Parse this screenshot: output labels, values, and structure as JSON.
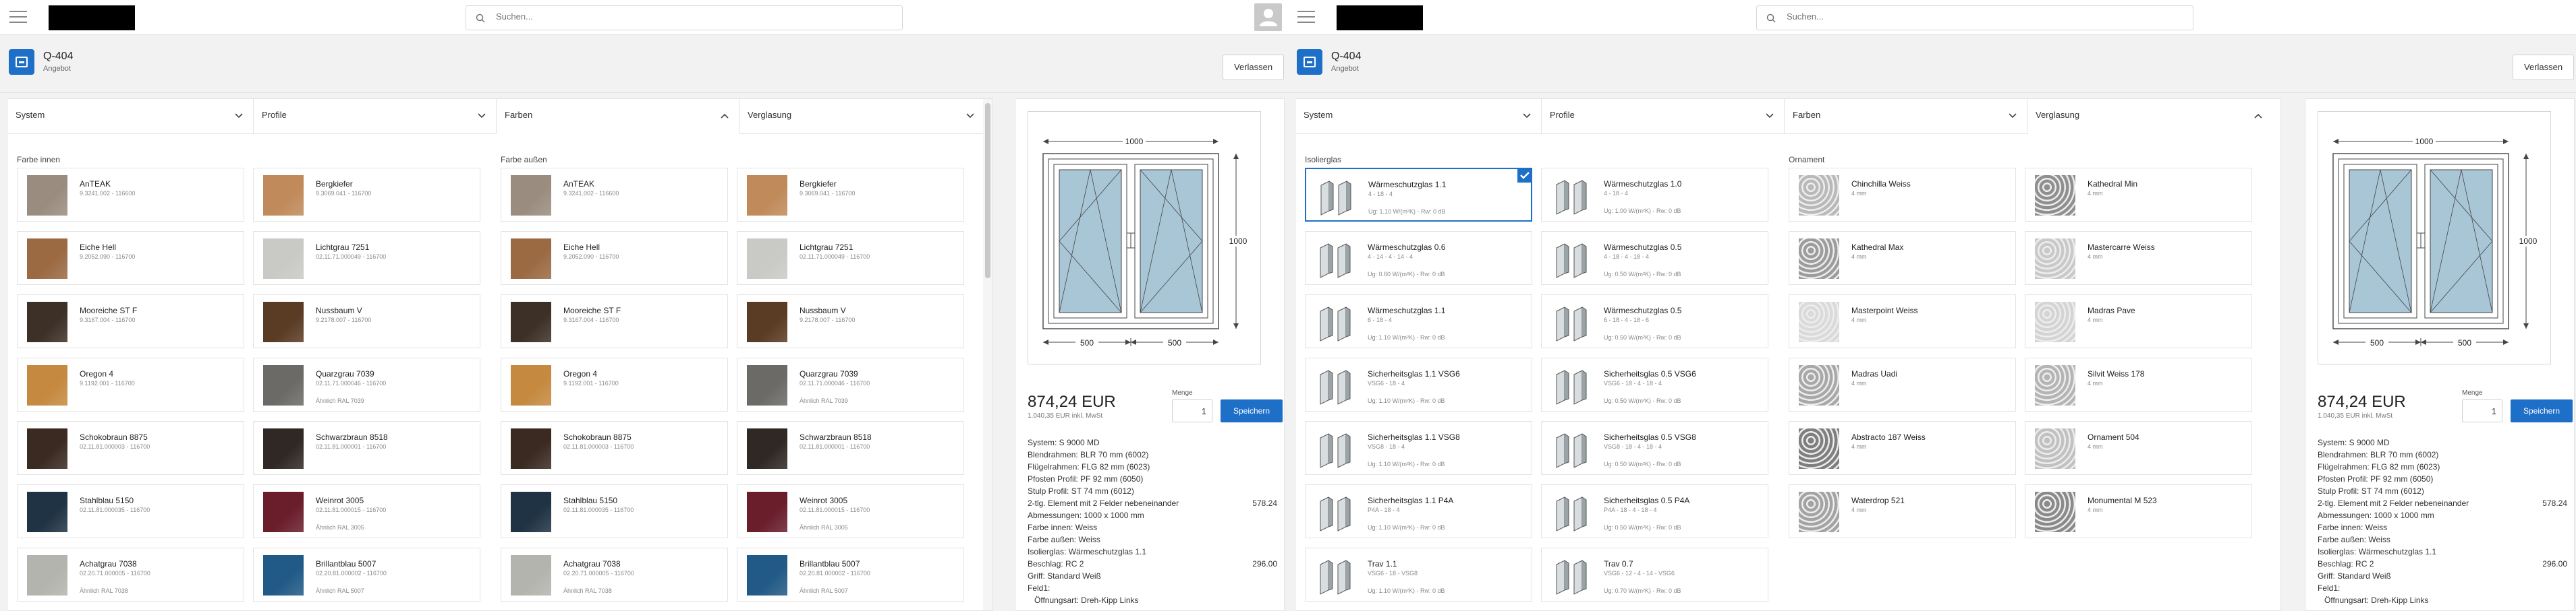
{
  "left": {
    "search_placeholder": "Suchen...",
    "quote_title": "Q-404",
    "quote_subtitle": "Angebot",
    "leave_label": "Verlassen",
    "tabs": [
      "System",
      "Profile",
      "Farben",
      "Verglasung"
    ],
    "section_inner": "Farbe innen",
    "section_outer": "Farbe außen",
    "colors": [
      {
        "name": "AnTEAK",
        "code": "9.3241.002 - 116600",
        "note": "",
        "color": "#9a8d80"
      },
      {
        "name": "Bergkiefer",
        "code": "9.3069.041 - 116700",
        "note": "",
        "color": "#c08a5a"
      },
      {
        "name": "Eiche Hell",
        "code": "9.2052.090 - 116700",
        "note": "",
        "color": "#9b6a43"
      },
      {
        "name": "Lichtgrau 7251",
        "code": "02.11.71.000049 - 116700",
        "note": "",
        "color": "#c9c9c6"
      },
      {
        "name": "Mooreiche ST F",
        "code": "9.3167.004 - 116700",
        "note": "",
        "color": "#3c3027"
      },
      {
        "name": "Nussbaum V",
        "code": "9.2178.007 - 116700",
        "note": "",
        "color": "#5a3b24"
      },
      {
        "name": "Oregon 4",
        "code": "9.1192.001 - 116700",
        "note": "",
        "color": "#c5893f"
      },
      {
        "name": "Quarzgrau 7039",
        "code": "02.11.71.000046 - 116700",
        "note": "Ähnlich RAL 7039",
        "color": "#6b6a66"
      },
      {
        "name": "Schokobraun 8875",
        "code": "02.11.81.000003 - 116700",
        "note": "",
        "color": "#3a2a22"
      },
      {
        "name": "Schwarzbraun 8518",
        "code": "02.11.81.000001 - 116700",
        "note": "",
        "color": "#2f2824"
      },
      {
        "name": "Stahlblau 5150",
        "code": "02.11.81.000035 - 116700",
        "note": "",
        "color": "#1f3344"
      },
      {
        "name": "Weinrot 3005",
        "code": "02.11.81.000015 - 116700",
        "note": "Ähnlich RAL 3005",
        "color": "#6a1e2c"
      },
      {
        "name": "Achatgrau 7038",
        "code": "02.20.71.000005 - 116700",
        "note": "Ähnlich RAL 7038",
        "color": "#b3b4ad"
      },
      {
        "name": "Brillantblau 5007",
        "code": "02.20.81.000002 - 116700",
        "note": "Ähnlich RAL 5007",
        "color": "#215a86"
      }
    ]
  },
  "right": {
    "search_placeholder": "Suchen...",
    "quote_title": "Q-404",
    "quote_subtitle": "Angebot",
    "leave_label": "Verlassen",
    "tabs": [
      "System",
      "Profile",
      "Farben",
      "Verglasung"
    ],
    "section_glass": "Isolierglas",
    "section_ornament": "Ornament",
    "glass": [
      {
        "name": "Wärmeschutzglas 1.1",
        "spec": "4 - 18 - 4",
        "ug": "Ug: 1.10 W/(m²K) - Rw: 0 dB",
        "selected": true
      },
      {
        "name": "Wärmeschutzglas 1.0",
        "spec": "4 - 18 - 4",
        "ug": "Ug: 1.00 W/(m²K) - Rw: 0 dB",
        "selected": false
      },
      {
        "name": "Wärmeschutzglas 0.6",
        "spec": "4 - 14 - 4 - 14 - 4",
        "ug": "Ug: 0.60 W/(m²K) - Rw: 0 dB",
        "selected": false
      },
      {
        "name": "Wärmeschutzglas 0.5",
        "spec": "4 - 18 - 4 - 18 - 4",
        "ug": "Ug: 0.50 W/(m²K) - Rw: 0 dB",
        "selected": false
      },
      {
        "name": "Wärmeschutzglas 1.1",
        "spec": "6 - 18 - 4",
        "ug": "Ug: 1.10 W/(m²K) - Rw: 0 dB",
        "selected": false
      },
      {
        "name": "Wärmeschutzglas 0.5",
        "spec": "6 - 18 - 4 - 18 - 6",
        "ug": "Ug: 0.50 W/(m²K) - Rw: 0 dB",
        "selected": false
      },
      {
        "name": "Sicherheitsglas 1.1 VSG6",
        "spec": "VSG6 - 18 - 4",
        "ug": "Ug: 1.10 W/(m²K) - Rw: 0 dB",
        "selected": false
      },
      {
        "name": "Sicherheitsglas 0.5 VSG6",
        "spec": "VSG6 - 18 - 4 - 18 - 4",
        "ug": "Ug: 0.50 W/(m²K) - Rw: 0 dB",
        "selected": false
      },
      {
        "name": "Sicherheitsglas 1.1 VSG8",
        "spec": "VSG8 - 18 - 4",
        "ug": "Ug: 1.10 W/(m²K) - Rw: 0 dB",
        "selected": false
      },
      {
        "name": "Sicherheitsglas 0.5 VSG8",
        "spec": "VSG8 - 18 - 4 - 18 - 4",
        "ug": "Ug: 0.50 W/(m²K) - Rw: 0 dB",
        "selected": false
      },
      {
        "name": "Sicherheitsglas 1.1 P4A",
        "spec": "P4A - 18 - 4",
        "ug": "Ug: 1.10 W/(m²K) - Rw: 0 dB",
        "selected": false
      },
      {
        "name": "Sicherheitsglas 0.5 P4A",
        "spec": "P4A - 18 - 4 - 18 - 4",
        "ug": "Ug: 0.50 W/(m²K) - Rw: 0 dB",
        "selected": false
      },
      {
        "name": "Trav 1.1",
        "spec": "VSG6 - 18 - VSG8",
        "ug": "Ug: 1.10 W/(m²K) - Rw: 0 dB",
        "selected": false
      },
      {
        "name": "Trav 0.7",
        "spec": "VSG6 - 12 - 4 - 14 - VSG6",
        "ug": "Ug: 0.70 W/(m²K) - Rw: 0 dB",
        "selected": false
      }
    ],
    "ornaments": [
      {
        "name": "Chinchilla Weiss",
        "spec": "4 mm",
        "color": "#b9b9b9"
      },
      {
        "name": "Kathedral Min",
        "spec": "4 mm",
        "color": "#8f8f8f"
      },
      {
        "name": "Kathedral Max",
        "spec": "4 mm",
        "color": "#9c9c9c"
      },
      {
        "name": "Mastercarre Weiss",
        "spec": "4 mm",
        "color": "#c9c9c9"
      },
      {
        "name": "Masterpoint Weiss",
        "spec": "4 mm",
        "color": "#dadada"
      },
      {
        "name": "Madras Pave",
        "spec": "4 mm",
        "color": "#d4d4d4"
      },
      {
        "name": "Madras Uadi",
        "spec": "4 mm",
        "color": "#a8a8a8"
      },
      {
        "name": "Silvit Weiss 178",
        "spec": "4 mm",
        "color": "#b4b4b4"
      },
      {
        "name": "Abstracto 187 Weiss",
        "spec": "4 mm",
        "color": "#7f7f7f"
      },
      {
        "name": "Ornament 504",
        "spec": "4 mm",
        "color": "#c1c1c1"
      },
      {
        "name": "Waterdrop 521",
        "spec": "4 mm",
        "color": "#a3a3a3"
      },
      {
        "name": "Monumental M 523",
        "spec": "4 mm",
        "color": "#8a8a8a"
      }
    ]
  },
  "summary": {
    "dim_width": "1000",
    "dim_height": "1000",
    "dim_left": "500",
    "dim_right": "500",
    "price": "874,24 EUR",
    "price_incl": "1.040,35 EUR inkl. MwSt",
    "qty_label": "Menge",
    "qty": "1",
    "save_label": "Speichern",
    "lines": [
      {
        "text": "System: S 9000 MD",
        "amount": "",
        "indent": false
      },
      {
        "text": "Blendrahmen: BLR 70 mm (6002)",
        "amount": "",
        "indent": false
      },
      {
        "text": "Flügelrahmen: FLG 82 mm (6023)",
        "amount": "",
        "indent": false
      },
      {
        "text": "Pfosten Profil: PF 92 mm (6050)",
        "amount": "",
        "indent": false
      },
      {
        "text": "Stulp Profil: ST 74 mm (6012)",
        "amount": "",
        "indent": false
      },
      {
        "text": "2-tlg. Element mit 2 Felder nebeneinander",
        "amount": "578.24",
        "indent": false
      },
      {
        "text": "Abmessungen: 1000 x 1000 mm",
        "amount": "",
        "indent": false
      },
      {
        "text": "Farbe innen: Weiss",
        "amount": "",
        "indent": false
      },
      {
        "text": "Farbe außen: Weiss",
        "amount": "",
        "indent": false
      },
      {
        "text": "Isolierglas: Wärmeschutzglas 1.1",
        "amount": "",
        "indent": false
      },
      {
        "text": "Beschlag: RC 2",
        "amount": "296.00",
        "indent": false
      },
      {
        "text": "Griff: Standard Weiß",
        "amount": "",
        "indent": false
      },
      {
        "text": "Feld1:",
        "amount": "",
        "indent": false
      },
      {
        "text": "Öffnungsart: Dreh-Kipp Links",
        "amount": "",
        "indent": true
      }
    ]
  }
}
